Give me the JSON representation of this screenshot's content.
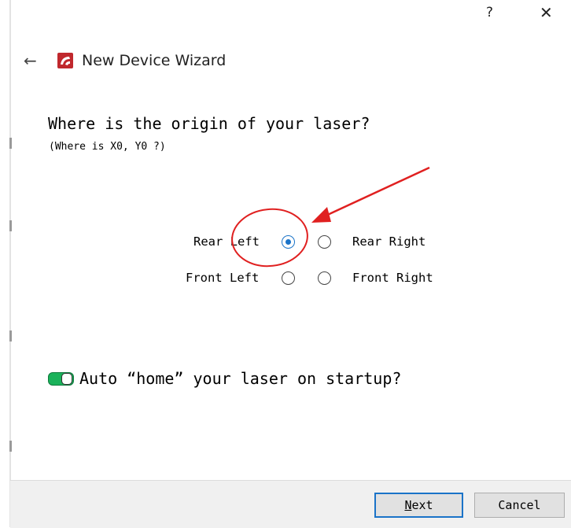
{
  "titlebar": {
    "help_label": "?",
    "close_label": "✕"
  },
  "header": {
    "back_label": "←",
    "title": "New Device Wizard"
  },
  "question": {
    "title": "Where is the origin of your laser?",
    "subtitle": "(Where is X0, Y0 ?)"
  },
  "origin_options": {
    "rear_left": "Rear Left",
    "rear_right": "Rear Right",
    "front_left": "Front Left",
    "front_right": "Front Right",
    "selected": "Rear Left"
  },
  "autohome": {
    "label": "Auto “home” your laser on startup?",
    "enabled": true
  },
  "footer": {
    "next_first": "N",
    "next_rest": "ext",
    "cancel_label": "Cancel"
  },
  "colors": {
    "accent": "#1a73c8",
    "annotation": "#e02020",
    "toggle_on": "#1ab25a"
  }
}
